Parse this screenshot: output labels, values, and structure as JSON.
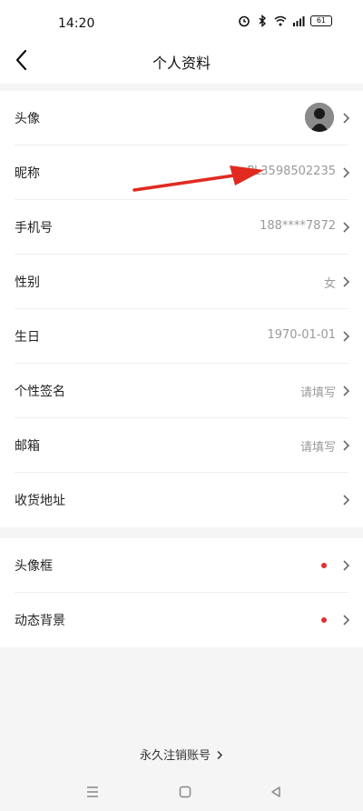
{
  "status_bar": {
    "time": "14:20",
    "battery": "61"
  },
  "header": {
    "title": "个人资料"
  },
  "profile_rows": [
    {
      "label": "头像",
      "value": ""
    },
    {
      "label": "昵称",
      "value": "PL3598502235"
    },
    {
      "label": "手机号",
      "value": "188****7872"
    },
    {
      "label": "性别",
      "value": "女"
    },
    {
      "label": "生日",
      "value": "1970-01-01"
    },
    {
      "label": "个性签名",
      "value": "请填写"
    },
    {
      "label": "邮箱",
      "value": "请填写"
    },
    {
      "label": "收货地址",
      "value": ""
    }
  ],
  "extra_rows": [
    {
      "label": "头像框",
      "has_red_dot": true
    },
    {
      "label": "动态背景",
      "has_red_dot": true
    }
  ],
  "footer": {
    "cancel_account": "永久注销账号"
  },
  "colors": {
    "accent_red": "#e0302e",
    "annotation_arrow": "#e02a20",
    "muted_text": "#9a9a9a"
  },
  "icons": {
    "back": "chevron-left-icon",
    "row_arrow": "chevron-right-icon",
    "nav_menu": "menu-icon",
    "nav_home": "home-square-icon",
    "nav_back": "back-triangle-icon"
  }
}
